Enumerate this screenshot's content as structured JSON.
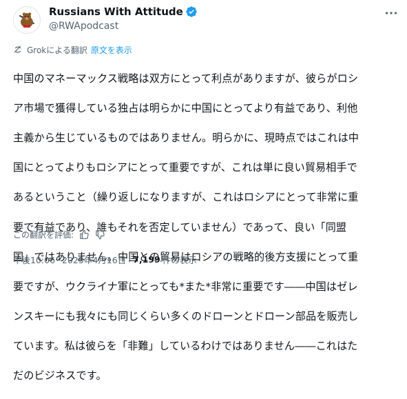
{
  "author": {
    "display_name": "Russians With Attitude",
    "handle": "@RWApodcast",
    "verified_color": "#1d9bf0"
  },
  "translation": {
    "label": "Grokによる翻訳",
    "show_original": "原文を表示"
  },
  "tweet": {
    "text": "中国のマネーマックス戦略は双方にとって利点がありますが、彼らがロシア市場で獲得している独占は明らかに中国にとってより有益であり、利他主義から生じているものではありません。明らかに、現時点ではこれは中国にとってよりもロシアにとって重要ですが、これは単に良い貿易相手であるということ（繰り返しになりますが、これはロシアにとって非常に重要で有益であり、誰もそれを否定していません）であって、良い「同盟国」ではありません。中国との貿易はロシアの戦略的後方支援にとって重要ですが、ウクライナ軍にとっても*また*非常に重要です――中国はゼレンスキーにも我々にも同じくらい多くのドローンとドローン部品を販売しています。私は彼らを「非難」しているわけではありません――これはただのビジネスです。",
    "lines": [
      "中国のマネーマックス戦略は双方にとって利点がありますが、彼らがロシ",
      "ア市場で獲得している独占は明らかに中国にとってより有益であり、利他",
      "主義から生じているものではありません。明らかに、現時点ではこれは中",
      "国にとってよりもロシアにとって重要ですが、これは単に良い貿易相手で",
      "あるということ（繰り返しになりますが、これはロシアにとって非常に重",
      "要で有益であり、誰もそれを否定していません）であって、良い「同盟",
      "国」ではありません。中国との貿易はロシアの戦略的後方支援にとって重",
      "要ですが、ウクライナ軍にとっても*また*非常に重要です――中国はゼレ",
      "ンスキーにも我々にも同じくらい多くのドローンとドローン部品を販売し",
      "ています。私は彼らを「非難」しているわけではありません――これはた",
      "だのビジネスです。"
    ]
  },
  "rating": {
    "label": "この翻訳を評価:"
  },
  "meta": {
    "time": "午後10:06",
    "separator": "·",
    "date": "2025年4月16日",
    "views_count": "7,199",
    "views_label": "件の表示"
  },
  "icons": {
    "avatar": "bear-with-rifle-avatar",
    "verified": "verified-badge-icon",
    "more": "more-options-icon",
    "grok": "grok-icon",
    "thumbs_up": "thumbs-up-icon",
    "thumbs_down": "thumbs-down-icon"
  }
}
